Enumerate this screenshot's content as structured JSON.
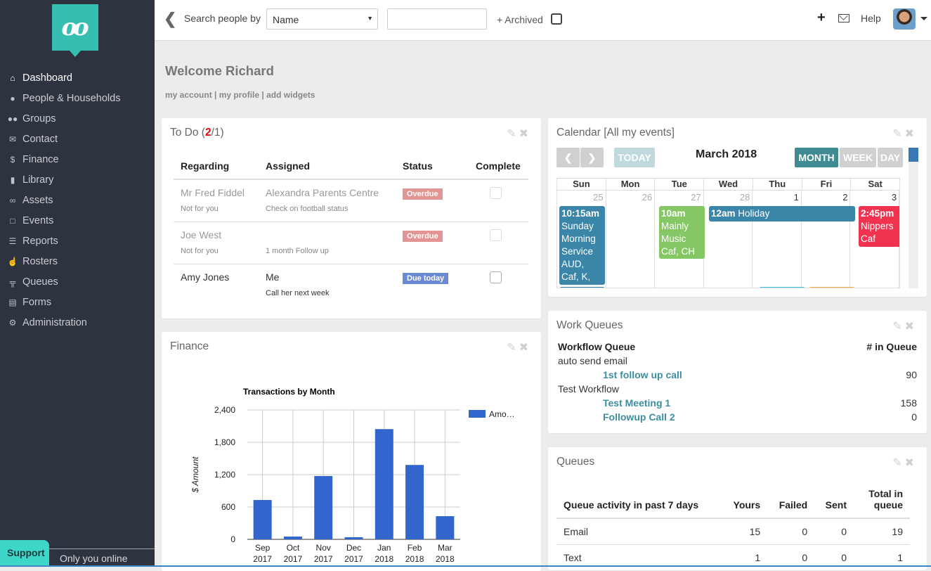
{
  "sidebar": {
    "logo": "oo",
    "items": [
      {
        "label": "Dashboard",
        "icon": "home-icon",
        "active": true
      },
      {
        "label": "People & Households",
        "icon": "user-icon"
      },
      {
        "label": "Groups",
        "icon": "users-icon"
      },
      {
        "label": "Contact",
        "icon": "envelope-icon"
      },
      {
        "label": "Finance",
        "icon": "dollar-icon"
      },
      {
        "label": "Library",
        "icon": "book-icon"
      },
      {
        "label": "Assets",
        "icon": "bicycle-icon"
      },
      {
        "label": "Events",
        "icon": "calendar-icon"
      },
      {
        "label": "Reports",
        "icon": "list-icon"
      },
      {
        "label": "Rosters",
        "icon": "hand-pointer-icon"
      },
      {
        "label": "Queues",
        "icon": "signpost-icon"
      },
      {
        "label": "Forms",
        "icon": "form-icon"
      },
      {
        "label": "Administration",
        "icon": "cogs-icon"
      }
    ],
    "support_label": "Support",
    "online_status": "Only you online"
  },
  "topbar": {
    "search_label": "Search people by",
    "search_by_selected": "Name",
    "search_value": "",
    "archived_label": "+ Archived",
    "archived_checked": false,
    "help_label": "Help"
  },
  "welcome": {
    "title": "Welcome Richard",
    "links": [
      "my account",
      "my profile",
      "add widgets"
    ]
  },
  "todo": {
    "title_prefix": "To Do (",
    "count_overdue": "2",
    "count_sep": "/",
    "count_total": "1",
    "title_suffix": ")",
    "headers": [
      "Regarding",
      "Assigned",
      "Status",
      "Complete"
    ],
    "rows": [
      {
        "regarding": "Mr Fred Fiddel",
        "assigned": "Alexandra Parents Centre",
        "status": "Overdue",
        "note_left": "Not for you",
        "note": "Check on football status",
        "faded": true
      },
      {
        "regarding": "Joe West",
        "assigned": "",
        "status": "Overdue",
        "note_left": "Not for you",
        "note": "1 month Follow up",
        "faded": true
      },
      {
        "regarding": "Amy Jones",
        "assigned": "Me",
        "status": "Due today",
        "note_left": "",
        "note": "Call her next week",
        "faded": false
      }
    ]
  },
  "calendar": {
    "title": "Calendar [All my events]",
    "today_label": "TODAY",
    "month_label": "March 2018",
    "views": [
      "MONTH",
      "WEEK",
      "DAY"
    ],
    "active_view": "MONTH",
    "weekdays": [
      "Sun",
      "Mon",
      "Tue",
      "Wed",
      "Thu",
      "Fri",
      "Sat"
    ],
    "days": [
      "25",
      "26",
      "27",
      "28",
      "1",
      "2",
      "3"
    ],
    "events": [
      {
        "time": "10:15am",
        "title": "Sunday Morning Service AUD, Caf, K, CH",
        "color": "#3a85a8"
      },
      {
        "time": "10am",
        "title": "Mainly Music Caf, CH",
        "color": "#84c764"
      },
      {
        "time": "12am",
        "title": "Holiday",
        "color": "#3a85a8"
      },
      {
        "time": "2:45pm",
        "title": "Nippers Caf",
        "color": "#f2334f"
      }
    ]
  },
  "work_queues": {
    "title": "Work Queues",
    "header_left": "Workflow Queue",
    "header_right": "# in Queue",
    "rows": [
      {
        "label": "auto send email",
        "type": "workflow"
      },
      {
        "label": "1st follow up call",
        "type": "queue",
        "count": "90"
      },
      {
        "label": "Test Workflow",
        "type": "workflow"
      },
      {
        "label": "Test Meeting 1",
        "type": "queue",
        "count": "158"
      },
      {
        "label": "Followup Call 2",
        "type": "queue",
        "count": "0"
      }
    ]
  },
  "queues": {
    "title": "Queues",
    "headers": [
      "Queue activity in past 7 days",
      "Yours",
      "Failed",
      "Sent",
      "Total in queue"
    ],
    "rows": [
      [
        "Email",
        "15",
        "0",
        "0",
        "19"
      ],
      [
        "Text",
        "1",
        "0",
        "0",
        "1"
      ]
    ]
  },
  "finance": {
    "title": "Finance"
  },
  "chart_data": {
    "type": "bar",
    "title": "Transactions by Month",
    "xlabel": "",
    "ylabel": "$ Amount",
    "categories": [
      "Sep 2017",
      "Oct 2017",
      "Nov 2017",
      "Dec 2017",
      "Jan 2018",
      "Feb 2018",
      "Mar 2018"
    ],
    "series": [
      {
        "name": "Amo…",
        "values": [
          730,
          52,
          1175,
          40,
          2045,
          1380,
          430
        ],
        "color": "#3366cc"
      }
    ],
    "yticks": [
      "0",
      "600",
      "1,200",
      "1,800",
      "2,400"
    ],
    "ylim": [
      0,
      2400
    ],
    "grid": true,
    "legend": "right"
  }
}
